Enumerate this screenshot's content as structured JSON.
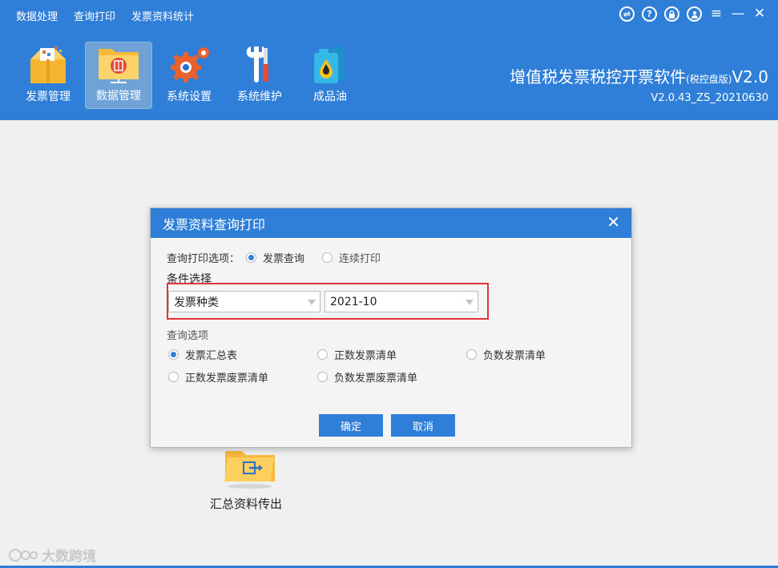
{
  "menubar": [
    "数据处理",
    "查询打印",
    "发票资料统计"
  ],
  "window_controls": [
    "switch-icon",
    "help-icon",
    "lock-icon",
    "user-icon",
    "menu-icon",
    "minimize-icon",
    "close-icon"
  ],
  "nav": [
    {
      "label": "发票管理",
      "icon": "invoice-box-icon",
      "active": false
    },
    {
      "label": "数据管理",
      "icon": "data-folder-icon",
      "active": true
    },
    {
      "label": "系统设置",
      "icon": "gears-icon",
      "active": false
    },
    {
      "label": "系统维护",
      "icon": "tools-icon",
      "active": false
    },
    {
      "label": "成品油",
      "icon": "oil-can-icon",
      "active": false
    }
  ],
  "brand": {
    "title": "增值税发票税控开票软件",
    "edition": "(税控盘版)",
    "version_suffix": "V2.0",
    "build": "V2.0.43_ZS_20210630"
  },
  "content": {
    "export_label": "汇总资料传出"
  },
  "dialog": {
    "title": "发票资料查询打印",
    "print_option_label": "查询打印选项：",
    "print_options": [
      {
        "label": "发票查询",
        "checked": true
      },
      {
        "label": "连续打印",
        "checked": false
      }
    ],
    "condition_title": "条件选择",
    "invoice_type_select": "发票种类",
    "period_select": "2021-10",
    "query_options_title": "查询选项",
    "query_options": [
      {
        "label": "发票汇总表",
        "checked": true
      },
      {
        "label": "正数发票清单",
        "checked": false
      },
      {
        "label": "负数发票清单",
        "checked": false
      },
      {
        "label": "正数发票废票清单",
        "checked": false
      },
      {
        "label": "负数发票废票清单",
        "checked": false
      }
    ],
    "ok_label": "确定",
    "cancel_label": "取消"
  },
  "watermark": "大数跨境",
  "colors": {
    "primary": "#2f7fd8",
    "highlight_box": "#e3323a",
    "background": "#f0f0f0"
  }
}
